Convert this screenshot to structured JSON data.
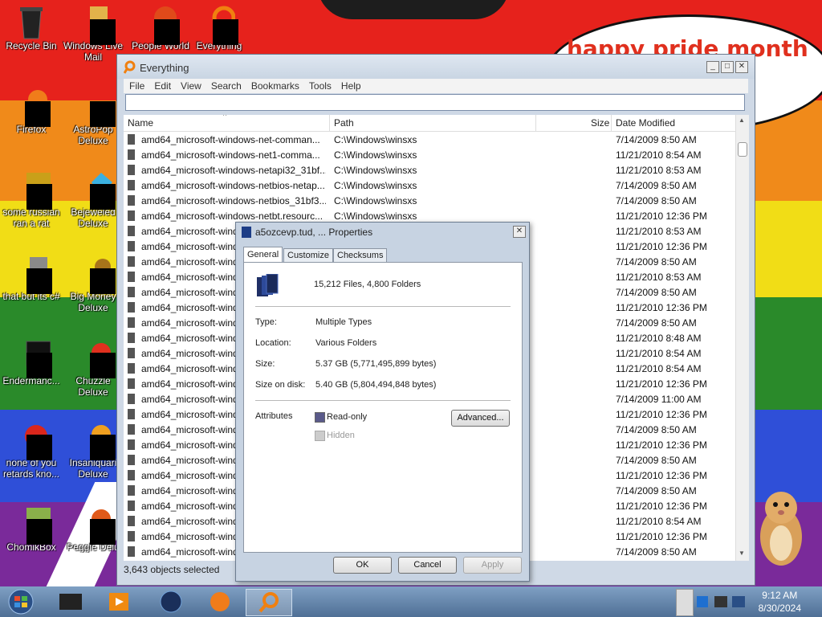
{
  "desktop": {
    "bubble_text": "happy pride month",
    "icons": [
      {
        "label": "Recycle Bin"
      },
      {
        "label": "Windows Live Mail"
      },
      {
        "label": "People World"
      },
      {
        "label": "Everything"
      },
      {
        "label": "Firefox"
      },
      {
        "label": "AstroPop Deluxe"
      },
      {
        "label": "some russian ran a rat"
      },
      {
        "label": "Bejeweled Deluxe"
      },
      {
        "label": "that but its c#"
      },
      {
        "label": "Big Money Deluxe"
      },
      {
        "label": "Endermanc..."
      },
      {
        "label": "Chuzzle Deluxe"
      },
      {
        "label": "none of you retards kno..."
      },
      {
        "label": "Insaniquari Deluxe"
      },
      {
        "label": "ChomikBox"
      },
      {
        "label": "Peggle Delu"
      }
    ]
  },
  "everything": {
    "title": "Everything",
    "menu": [
      "File",
      "Edit",
      "View",
      "Search",
      "Bookmarks",
      "Tools",
      "Help"
    ],
    "search_value": "",
    "columns": {
      "name": "Name",
      "path": "Path",
      "size": "Size",
      "date": "Date Modified"
    },
    "rows": [
      {
        "name": "amd64_microsoft-windows-net-comman...",
        "path": "C:\\Windows\\winsxs",
        "date": "7/14/2009 8:50 AM"
      },
      {
        "name": "amd64_microsoft-windows-net1-comma...",
        "path": "C:\\Windows\\winsxs",
        "date": "11/21/2010 8:54 AM"
      },
      {
        "name": "amd64_microsoft-windows-netapi32_31bf...",
        "path": "C:\\Windows\\winsxs",
        "date": "11/21/2010 8:53 AM"
      },
      {
        "name": "amd64_microsoft-windows-netbios-netap...",
        "path": "C:\\Windows\\winsxs",
        "date": "7/14/2009 8:50 AM"
      },
      {
        "name": "amd64_microsoft-windows-netbios_31bf3...",
        "path": "C:\\Windows\\winsxs",
        "date": "7/14/2009 8:50 AM"
      },
      {
        "name": "amd64_microsoft-windows-netbt.resourc...",
        "path": "C:\\Windows\\winsxs",
        "date": "11/21/2010 12:36 PM"
      },
      {
        "name": "amd64_microsoft-wind",
        "path": "",
        "date": "11/21/2010 8:53 AM"
      },
      {
        "name": "amd64_microsoft-wind",
        "path": "",
        "date": "11/21/2010 12:36 PM"
      },
      {
        "name": "amd64_microsoft-wind",
        "path": "",
        "date": "7/14/2009 8:50 AM"
      },
      {
        "name": "amd64_microsoft-wind",
        "path": "",
        "date": "11/21/2010 8:53 AM"
      },
      {
        "name": "amd64_microsoft-wind",
        "path": "",
        "date": "7/14/2009 8:50 AM"
      },
      {
        "name": "amd64_microsoft-wind",
        "path": "",
        "date": "11/21/2010 12:36 PM"
      },
      {
        "name": "amd64_microsoft-wind",
        "path": "",
        "date": "7/14/2009 8:50 AM"
      },
      {
        "name": "amd64_microsoft-wind",
        "path": "",
        "date": "11/21/2010 8:48 AM"
      },
      {
        "name": "amd64_microsoft-wind",
        "path": "",
        "date": "11/21/2010 8:54 AM"
      },
      {
        "name": "amd64_microsoft-wind",
        "path": "",
        "date": "11/21/2010 8:54 AM"
      },
      {
        "name": "amd64_microsoft-wind",
        "path": "",
        "date": "11/21/2010 12:36 PM"
      },
      {
        "name": "amd64_microsoft-wind",
        "path": "",
        "date": "7/14/2009 11:00 AM"
      },
      {
        "name": "amd64_microsoft-wind",
        "path": "",
        "date": "11/21/2010 12:36 PM"
      },
      {
        "name": "amd64_microsoft-wind",
        "path": "",
        "date": "7/14/2009 8:50 AM"
      },
      {
        "name": "amd64_microsoft-wind",
        "path": "",
        "date": "11/21/2010 12:36 PM"
      },
      {
        "name": "amd64_microsoft-wind",
        "path": "",
        "date": "7/14/2009 8:50 AM"
      },
      {
        "name": "amd64_microsoft-wind",
        "path": "",
        "date": "11/21/2010 12:36 PM"
      },
      {
        "name": "amd64_microsoft-wind",
        "path": "",
        "date": "7/14/2009 8:50 AM"
      },
      {
        "name": "amd64_microsoft-wind",
        "path": "",
        "date": "11/21/2010 12:36 PM"
      },
      {
        "name": "amd64_microsoft-wind",
        "path": "",
        "date": "11/21/2010 8:54 AM"
      },
      {
        "name": "amd64_microsoft-wind",
        "path": "",
        "date": "11/21/2010 12:36 PM"
      },
      {
        "name": "amd64_microsoft-wind",
        "path": "",
        "date": "7/14/2009 8:50 AM"
      }
    ],
    "status": "3,643 objects selected"
  },
  "properties": {
    "title": "a5ozcevp.tud, ... Properties",
    "tabs": [
      "General",
      "Customize",
      "Checksums"
    ],
    "summary": "15,212 Files, 4,800 Folders",
    "type_label": "Type:",
    "type_value": "Multiple Types",
    "location_label": "Location:",
    "location_value": "Various Folders",
    "size_label": "Size:",
    "size_value": "5.37 GB (5,771,495,899 bytes)",
    "disk_label": "Size on disk:",
    "disk_value": "5.40 GB (5,804,494,848 bytes)",
    "attributes_label": "Attributes",
    "readonly_label": "Read-only",
    "hidden_label": "Hidden",
    "advanced_label": "Advanced...",
    "ok_label": "OK",
    "cancel_label": "Cancel",
    "apply_label": "Apply"
  },
  "taskbar": {
    "time": "9:12 AM",
    "date": "8/30/2024"
  }
}
